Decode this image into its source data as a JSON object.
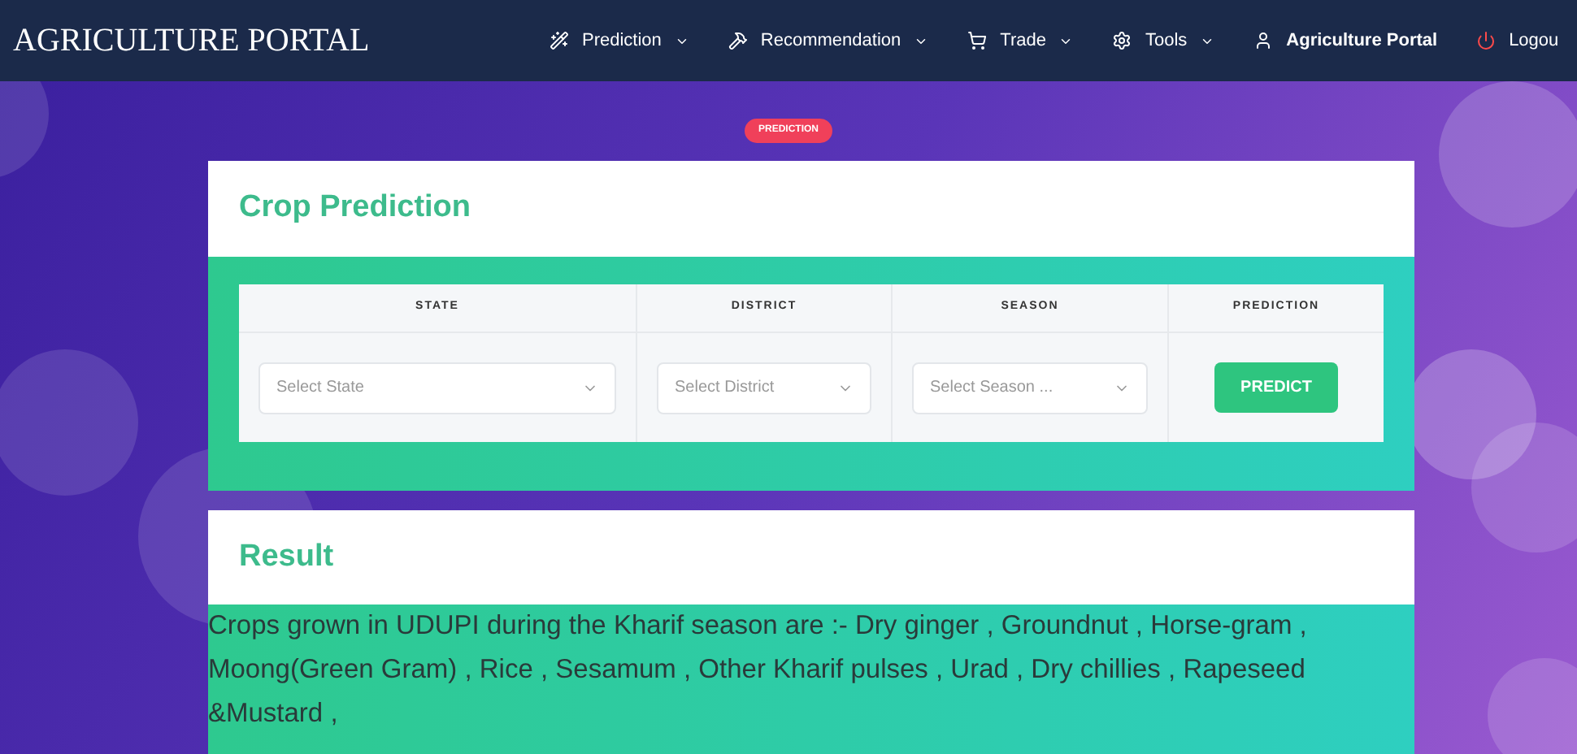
{
  "navbar": {
    "brand": "AGRICULTURE PORTAL",
    "items": [
      {
        "kind": "wand",
        "label": "Prediction",
        "dropdown": true
      },
      {
        "kind": "hammer",
        "label": "Recommendation",
        "dropdown": true
      },
      {
        "kind": "cart",
        "label": "Trade",
        "dropdown": true
      },
      {
        "kind": "gear",
        "label": "Tools",
        "dropdown": true
      },
      {
        "kind": "user",
        "label": "Agriculture Portal",
        "dropdown": false
      },
      {
        "kind": "power",
        "label": "Logou",
        "dropdown": false
      }
    ]
  },
  "badge": "PREDICTION",
  "prediction_card": {
    "title": "Crop Prediction",
    "columns": [
      {
        "kind": "select",
        "heading": "STATE",
        "placeholder": "Select State"
      },
      {
        "kind": "select",
        "heading": "DISTRICT",
        "placeholder": "Select District"
      },
      {
        "kind": "select",
        "heading": "SEASON",
        "placeholder": "Select Season ..."
      },
      {
        "kind": "button",
        "heading": "PREDICTION",
        "label": "PREDICT"
      }
    ]
  },
  "result_card": {
    "title": "Result",
    "text": "Crops grown in UDUPI during the Kharif season are :- Dry ginger , Groundnut , Horse-gram , Moong(Green Gram) , Rice , Sesamum , Other Kharif pulses , Urad , Dry chillies , Rapeseed &Mustard ,"
  }
}
